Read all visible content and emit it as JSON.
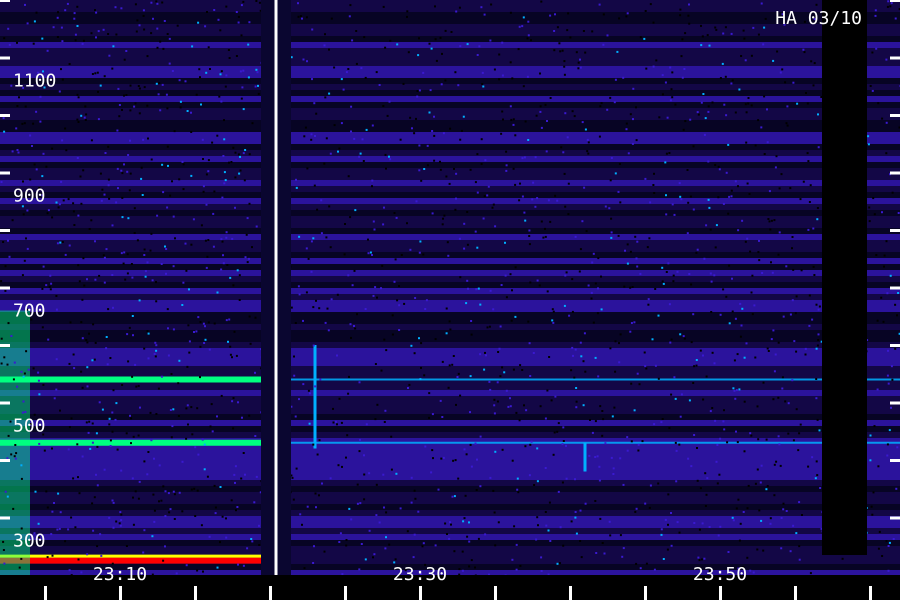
{
  "chart_data": {
    "type": "heatmap",
    "title": "",
    "station_label": "HA 03/10",
    "xlabel": "",
    "ylabel": "",
    "x_axis": {
      "unit": "UT time",
      "range": [
        "23:02",
        "23:62"
      ],
      "labeled_ticks": [
        "23:10",
        "23:30",
        "23:50"
      ],
      "minor_tick_interval_min": 5
    },
    "y_axis": {
      "unit": "frequency",
      "range": [
        240,
        1240
      ],
      "labeled_ticks": [
        300,
        500,
        700,
        900,
        1100
      ],
      "minor_tick_interval": 100
    },
    "colormap": [
      "#000000",
      "#1a0a5e",
      "#3a1ad0",
      "#00b0ff",
      "#00ff80",
      "#ffff00",
      "#ff8000",
      "#ff0000"
    ],
    "data_gaps": [
      {
        "start": "23:19.4",
        "end": "23:21.4",
        "type": "marker-line"
      },
      {
        "start": "23:56.8",
        "end": "23:59.8",
        "type": "no-data"
      }
    ],
    "features": [
      {
        "name": "emission-line-1",
        "freq": 580,
        "strength": "strong"
      },
      {
        "name": "emission-line-2",
        "freq": 470,
        "strength": "strong"
      },
      {
        "name": "emission-band-base",
        "freq": 265,
        "strength": "very strong"
      },
      {
        "name": "burst-1",
        "time": "23:23.0",
        "freq_range": [
          460,
          640
        ]
      },
      {
        "name": "burst-2",
        "time": "23:41.0",
        "freq_range": [
          420,
          470
        ]
      }
    ],
    "grid": false,
    "legend": "none"
  }
}
